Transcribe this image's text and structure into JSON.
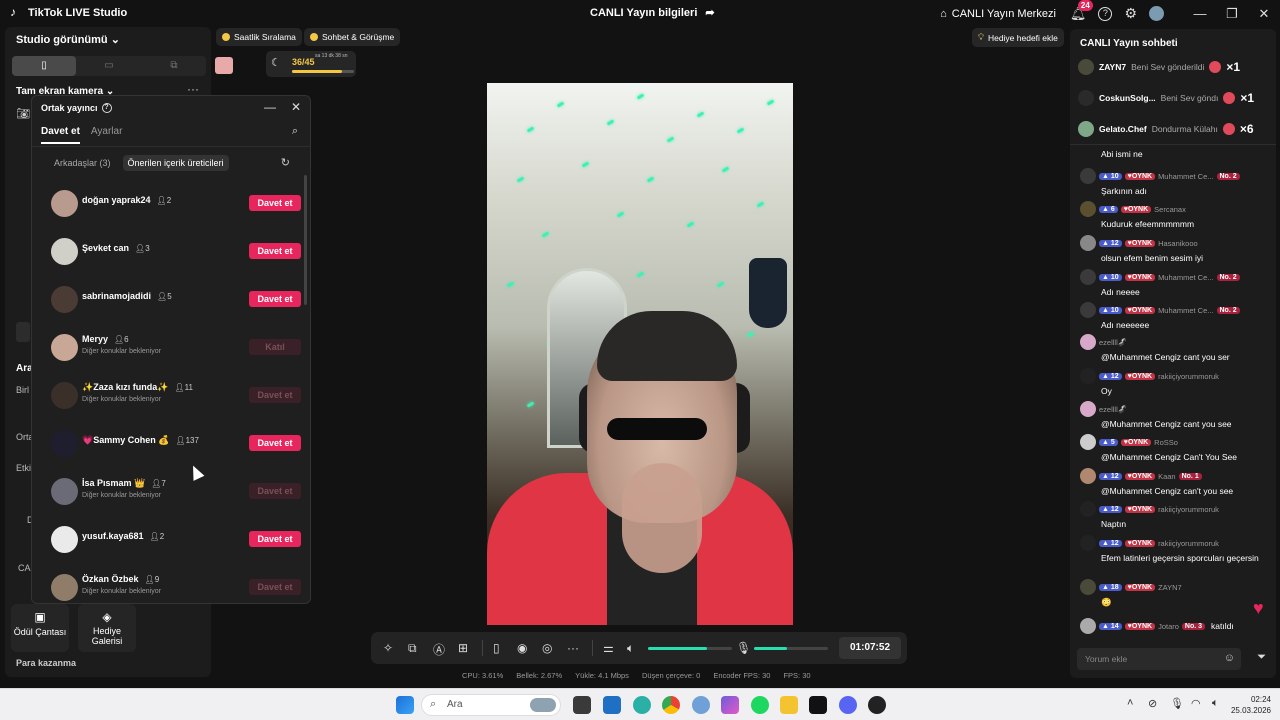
{
  "titlebar": {
    "app_name": "TikTok LIVE Studio",
    "center_title": "CANLI Yayın bilgileri",
    "live_center": "CANLI Yayın Merkezi",
    "notif_count": "24"
  },
  "left": {
    "studio_view": "Studio görünümü",
    "fullscreen_camera": "Tam ekran kamera",
    "side_letters": [
      "Ara",
      "Birl",
      "Orta",
      "Etki",
      "D",
      "CA"
    ],
    "tile_reward": "Ödül Çantası",
    "tile_gift_gallery": "Hediye Galerisi",
    "para": "Para kazanma"
  },
  "popup": {
    "title": "Ortak yayıncı",
    "tabs": [
      "Davet et",
      "Ayarlar"
    ],
    "subtabs": [
      "Arkadaşlar (3)",
      "Önerilen içerik üreticileri"
    ],
    "rows": [
      {
        "name": "doğan yaprak24",
        "count": "2",
        "sub": "",
        "btn": "Davet et",
        "state": "on",
        "color": "#b89a8e"
      },
      {
        "name": "Şevket can",
        "count": "3",
        "sub": "",
        "btn": "Davet et",
        "state": "on",
        "color": "#d0cfc8"
      },
      {
        "name": "sabrinamojadidi",
        "count": "5",
        "sub": "",
        "btn": "Davet et",
        "state": "on",
        "color": "#4a3b35"
      },
      {
        "name": "Meryy",
        "count": "6",
        "sub": "Diğer konuklar bekleniyor",
        "btn": "Katıl",
        "state": "off",
        "color": "#c9a796"
      },
      {
        "name": "✨Zaza kızı funda✨",
        "count": "11",
        "sub": "Diğer konuklar bekleniyor",
        "btn": "Davet et",
        "state": "off",
        "color": "#3b3029"
      },
      {
        "name": "💗Sammy Cohen 💰",
        "count": "137",
        "sub": "",
        "btn": "Davet et",
        "state": "on",
        "color": "#1e1e2e"
      },
      {
        "name": "İsa Pısmam 👑",
        "count": "7",
        "sub": "Diğer konuklar bekleniyor",
        "btn": "Davet et",
        "state": "off",
        "color": "#6b6b78"
      },
      {
        "name": "yusuf.kaya681",
        "count": "2",
        "sub": "",
        "btn": "Davet et",
        "state": "on",
        "color": "#eaeaea"
      },
      {
        "name": "Özkan Özbek",
        "count": "9",
        "sub": "Diğer konuklar bekleniyor",
        "btn": "Davet et",
        "state": "off",
        "color": "#8f7d6a"
      }
    ]
  },
  "top": {
    "ranking": "Saatlik Sıralama",
    "chat_meet": "Sohbet & Görüşme",
    "goal": "36/45",
    "timer": "sa 13 dk 38 sn",
    "gift_goal": "Hediye hedefi ekle"
  },
  "controls": {
    "time": "01:07:52",
    "volume": 0.7,
    "mic": 0.45
  },
  "stats": {
    "cpu": "CPU:  3.61%",
    "mem": "Bellek:  2.67%",
    "upload": "Yükle:  4.1 Mbps",
    "drop": "Düşen çerçeve:  0",
    "encoder": "Encoder FPS:  30",
    "fps": "FPS:  30"
  },
  "chat": {
    "title": "CANLI Yayın sohbeti",
    "gifts": [
      {
        "user": "ZAYN7",
        "text": "Beni Sev gönderildi",
        "mult": "×1",
        "color": "#4a4a3a"
      },
      {
        "user": "CoskunSolg...",
        "text": "Beni Sev göndı",
        "mult": "×1",
        "color": "#2a2a2a"
      },
      {
        "user": "Gelato.Chef",
        "text": "Dondurma Külahı",
        "mult": "×6",
        "color": "#7fa888"
      }
    ],
    "messages": [
      {
        "lvl": "",
        "tag": "",
        "user": "",
        "nob": "",
        "text": "Abi ismi ne",
        "color": ""
      },
      {
        "lvl": "10",
        "tag": "OYNK",
        "user": "Muhammet Ce...",
        "nob": "No. 2",
        "text": "Şarkının adı",
        "color": "#3a3a3a"
      },
      {
        "lvl": "6",
        "tag": "OYNK",
        "user": "Sercanax",
        "nob": "",
        "text": "Kuduruk efeemmmmmm",
        "color": "#5a5030"
      },
      {
        "lvl": "12",
        "tag": "OYNK",
        "user": "Hasanikooo",
        "nob": "",
        "text": "olsun efem benim sesim iyi",
        "color": "#888"
      },
      {
        "lvl": "10",
        "tag": "OYNK",
        "user": "Muhammet Ce...",
        "nob": "No. 2",
        "text": "Adı neeee",
        "color": "#3a3a3a"
      },
      {
        "lvl": "10",
        "tag": "OYNK",
        "user": "Muhammet Ce...",
        "nob": "No. 2",
        "text": "Adı neeeeee",
        "color": "#3a3a3a"
      },
      {
        "lvl": "",
        "tag": "",
        "user": "ezellll🦨",
        "nob": "",
        "text": "@Muhammet Cengiz cant you ser",
        "color": "#d8a8c8"
      },
      {
        "lvl": "12",
        "tag": "OYNK",
        "user": "rakiiçiyorummoruk",
        "nob": "",
        "text": "Oy",
        "color": "#222"
      },
      {
        "lvl": "",
        "tag": "",
        "user": "ezellll🦨",
        "nob": "",
        "text": "@Muhammet Cengiz cant you see",
        "color": "#d8a8c8"
      },
      {
        "lvl": "5",
        "tag": "OYNK",
        "user": "RoSSo",
        "nob": "",
        "text": "@Muhammet Cengiz Can't You See",
        "color": "#ccc"
      },
      {
        "lvl": "12",
        "tag": "OYNK",
        "user": "Kaan",
        "nob": "No. 1",
        "text": "@Muhammet Cengiz can't you see",
        "color": "#b08870"
      },
      {
        "lvl": "12",
        "tag": "OYNK",
        "user": "rakiiçiyorummoruk",
        "nob": "",
        "text": "Naptın",
        "color": "#222"
      },
      {
        "lvl": "12",
        "tag": "OYNK",
        "user": "rakiiçiyorummoruk",
        "nob": "",
        "text": "Efem latinleri geçersin sporcuları geçersin",
        "color": "#222"
      },
      {
        "lvl": "18",
        "tag": "OYNK",
        "user": "ZAYN7",
        "nob": "",
        "text": "😳",
        "color": "#4a4a3a"
      },
      {
        "lvl": "14",
        "tag": "OYNK",
        "user": "Jotaro",
        "nob": "No. 3",
        "text": "katıldı",
        "color": "#aaa"
      }
    ],
    "comment_placeholder": "Yorum ekle"
  },
  "taskbar": {
    "search": "Ara",
    "time": "02:24",
    "date": "25.03.2026"
  }
}
